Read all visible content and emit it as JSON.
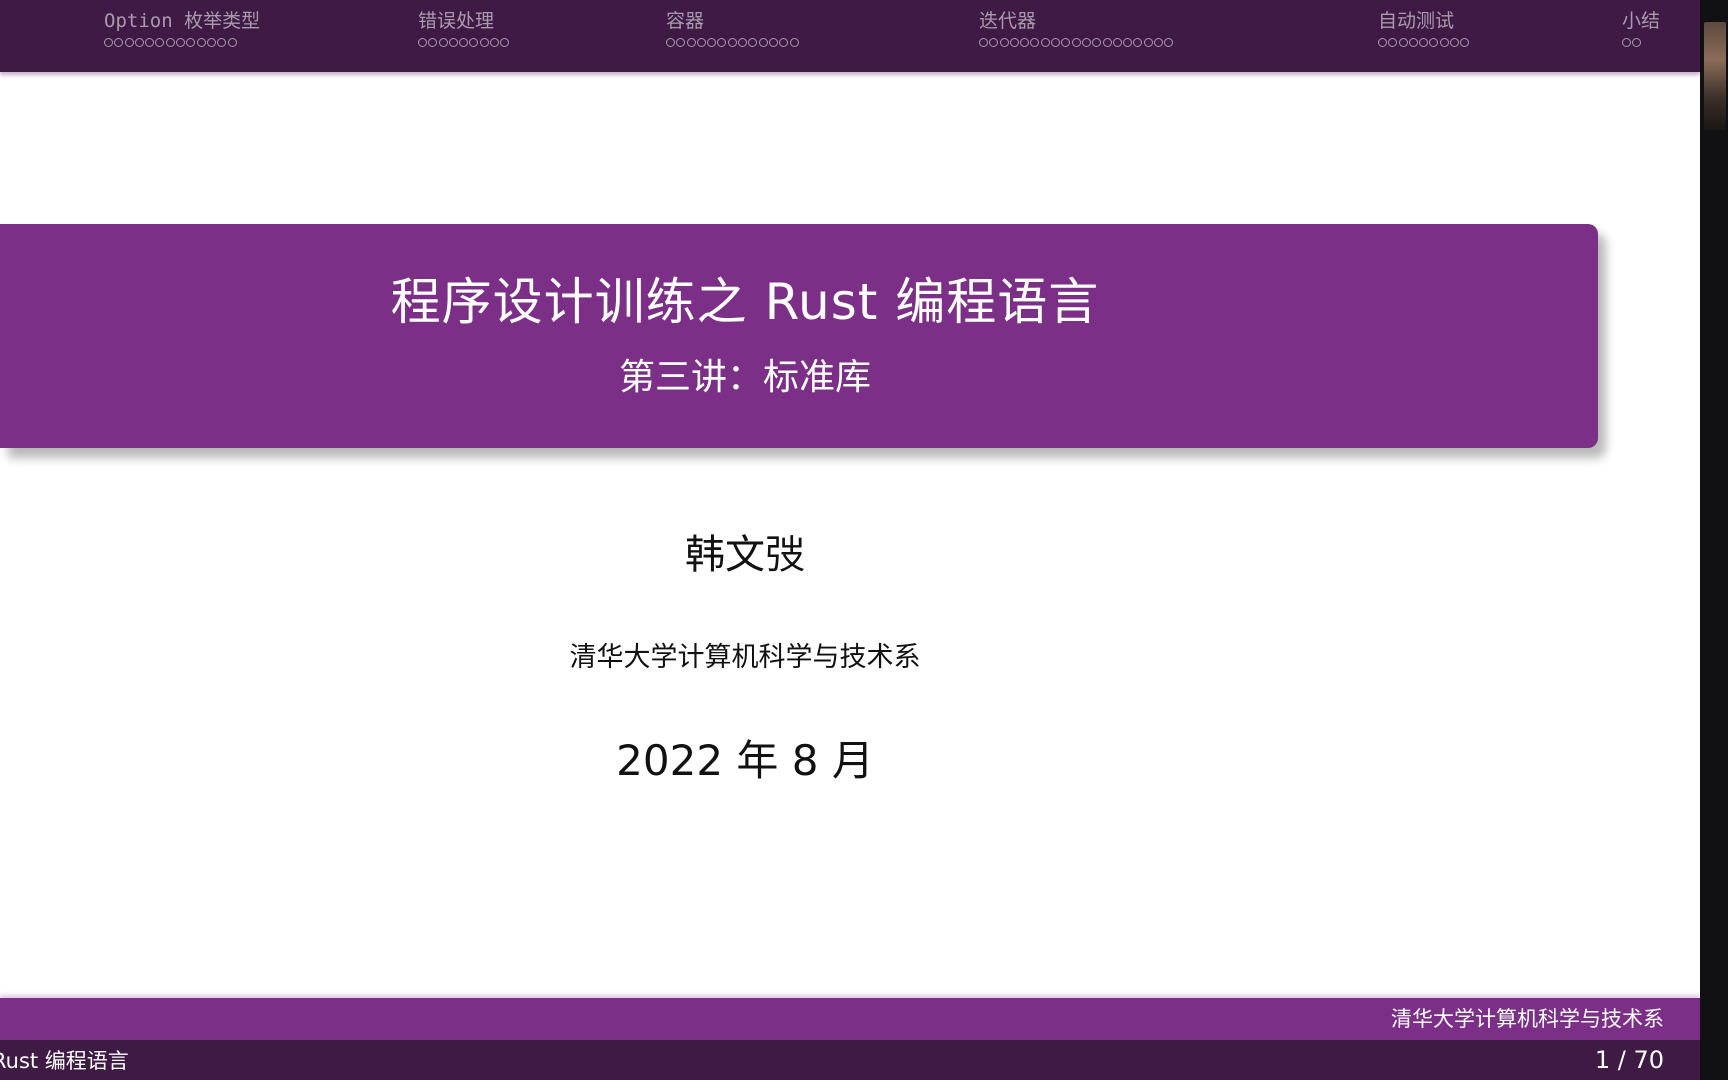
{
  "colors": {
    "nav_bar": "#3e1a45",
    "title_box": "#7b2f87",
    "footer_top": "#7b2f87",
    "footer_bottom": "#3e1a45",
    "nav_text": "#a99aad"
  },
  "nav": {
    "sections": [
      {
        "label": "Option 枚举类型",
        "dots": 13
      },
      {
        "label": "错误处理",
        "dots": 9
      },
      {
        "label": "容器",
        "dots": 13
      },
      {
        "label": "迭代器",
        "dots": 19
      },
      {
        "label": "自动测试",
        "dots": 9
      },
      {
        "label": "小结",
        "dots": 2
      }
    ]
  },
  "title": {
    "main": "程序设计训练之 Rust 编程语言",
    "subtitle": "第三讲：标准库"
  },
  "author": "韩文弢",
  "institute": "清华大学计算机科学与技术系",
  "date": "2022 年 8 月",
  "footer": {
    "institute": "清华大学计算机科学与技术系",
    "short_title": "Rust 编程语言",
    "page_indicator": "1 / 70"
  }
}
